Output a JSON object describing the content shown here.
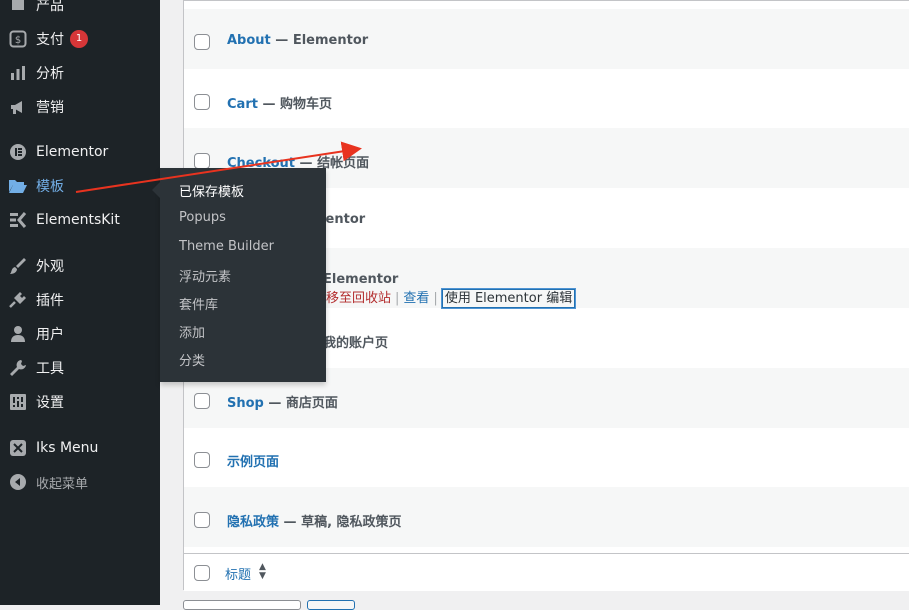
{
  "sidebar": {
    "items": [
      {
        "label": "产品",
        "icon": "archive-icon"
      },
      {
        "label": "支付",
        "icon": "payments-icon",
        "badge": "1"
      },
      {
        "label": "分析",
        "icon": "analytics-icon"
      },
      {
        "label": "营销",
        "icon": "megaphone-icon"
      },
      {
        "label": "Elementor",
        "icon": "elementor-icon"
      },
      {
        "label": "模板",
        "icon": "folder-open-icon"
      },
      {
        "label": "ElementsKit",
        "icon": "elementskit-icon"
      },
      {
        "label": "外观",
        "icon": "paintbrush-icon"
      },
      {
        "label": "插件",
        "icon": "plugins-icon"
      },
      {
        "label": "用户",
        "icon": "users-icon"
      },
      {
        "label": "工具",
        "icon": "wrench-icon"
      },
      {
        "label": "设置",
        "icon": "settings-icon"
      },
      {
        "label": "Iks Menu",
        "icon": "iks-menu-icon"
      },
      {
        "label": "收起菜单",
        "icon": "collapse-icon"
      }
    ],
    "flyout": [
      "已保存模板",
      "Popups",
      "Theme Builder",
      "浮动元素",
      "套件库",
      "添加",
      "分类"
    ]
  },
  "table": {
    "rows": [
      {
        "title": "About",
        "suffix": " — Elementor"
      },
      {
        "title": "Cart",
        "suffix": " — 购物车页"
      },
      {
        "title": "Checkout",
        "suffix": " — 结帐页面"
      },
      {
        "title": "",
        "suffix": "mentor"
      },
      {
        "title": "",
        "suffix": "Elementor"
      },
      {
        "title": "",
        "suffix": "我的账户页"
      },
      {
        "title": "Shop",
        "suffix": " — 商店页面"
      },
      {
        "title": "示例页面",
        "suffix": ""
      },
      {
        "title": "隐私政策",
        "suffix": " — 草稿, 隐私政策页"
      }
    ],
    "row_actions": {
      "trash": "移至回收站",
      "sep": "|",
      "view": "查看",
      "edit": "使用 Elementor 编辑"
    },
    "footer_column": "标题",
    "sort_glyphs": {
      "up": "▲",
      "down": "▼"
    }
  },
  "colors": {
    "accent": "#2271b1",
    "sidebar": "#1d2327",
    "badge": "#d63638",
    "arrow": "#e8331f"
  }
}
